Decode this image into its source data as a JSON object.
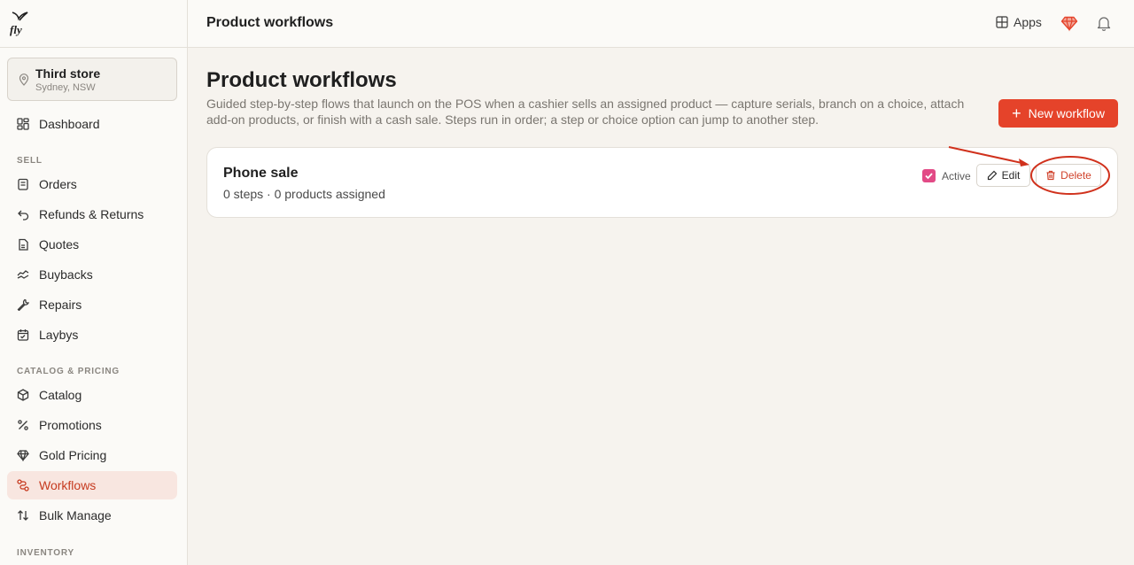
{
  "app": {
    "logo_text": "fly"
  },
  "store": {
    "name": "Third store",
    "location": "Sydney, NSW"
  },
  "sidebar": {
    "top_items": [
      {
        "label": "Dashboard",
        "icon": "dashboard-icon"
      }
    ],
    "sections": [
      {
        "label": "SELL",
        "items": [
          {
            "label": "Orders",
            "icon": "orders-icon"
          },
          {
            "label": "Refunds & Returns",
            "icon": "refund-icon"
          },
          {
            "label": "Quotes",
            "icon": "quotes-icon"
          },
          {
            "label": "Buybacks",
            "icon": "buybacks-icon"
          },
          {
            "label": "Repairs",
            "icon": "wrench-icon"
          },
          {
            "label": "Laybys",
            "icon": "calendar-icon"
          }
        ]
      },
      {
        "label": "CATALOG & PRICING",
        "items": [
          {
            "label": "Catalog",
            "icon": "box-icon"
          },
          {
            "label": "Promotions",
            "icon": "percent-icon"
          },
          {
            "label": "Gold Pricing",
            "icon": "gem-icon"
          },
          {
            "label": "Workflows",
            "icon": "workflow-icon",
            "active": true
          },
          {
            "label": "Bulk Manage",
            "icon": "sort-arrows-icon"
          }
        ]
      },
      {
        "label": "INVENTORY",
        "items": []
      }
    ]
  },
  "topbar": {
    "title": "Product workflows",
    "apps_label": "Apps"
  },
  "main": {
    "title": "Product workflows",
    "description": "Guided step-by-step flows that launch on the POS when a cashier sells an assigned product — capture serials, branch on a choice, attach add-on products, or finish with a cash sale. Steps run in order; a step or choice option can jump to another step.",
    "new_button": "New workflow",
    "workflows": [
      {
        "name": "Phone sale",
        "summary": "0 steps · 0 products assigned",
        "active_label": "Active",
        "active": true,
        "edit_label": "Edit",
        "delete_label": "Delete"
      }
    ]
  },
  "colors": {
    "accent": "#e5432a",
    "active_nav_bg": "#f8e6e0",
    "checkbox": "#e24a86",
    "annotation": "#d0311c"
  }
}
